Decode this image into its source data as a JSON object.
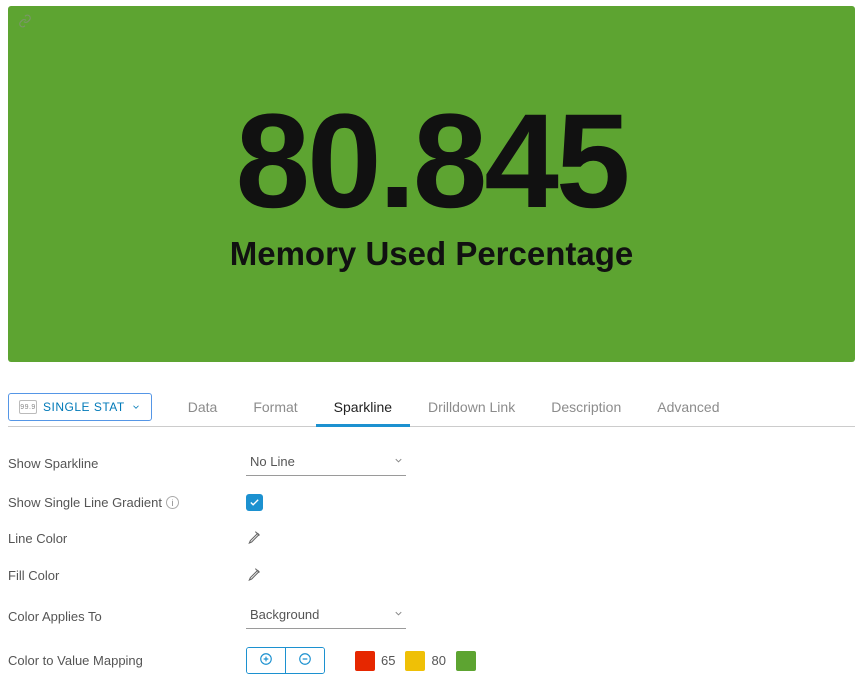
{
  "stat": {
    "value": "80.845",
    "label": "Memory Used Percentage",
    "background_color": "#5DA431"
  },
  "viz_type": {
    "label": "SINGLE STAT",
    "mini_value": "99.9"
  },
  "tabs": [
    {
      "label": "Data"
    },
    {
      "label": "Format"
    },
    {
      "label": "Sparkline",
      "active": true
    },
    {
      "label": "Drilldown Link"
    },
    {
      "label": "Description"
    },
    {
      "label": "Advanced"
    }
  ],
  "form": {
    "show_sparkline": {
      "label": "Show Sparkline",
      "value": "No Line"
    },
    "show_gradient": {
      "label": "Show Single Line Gradient",
      "checked": true
    },
    "line_color": {
      "label": "Line Color"
    },
    "fill_color": {
      "label": "Fill Color"
    },
    "color_applies_to": {
      "label": "Color Applies To",
      "value": "Background"
    },
    "color_mapping": {
      "label": "Color to Value Mapping",
      "items": [
        {
          "color": "#E62700",
          "value": "65"
        },
        {
          "color": "#EFC006",
          "value": "80"
        },
        {
          "color": "#5DA431",
          "value": ""
        }
      ]
    }
  }
}
